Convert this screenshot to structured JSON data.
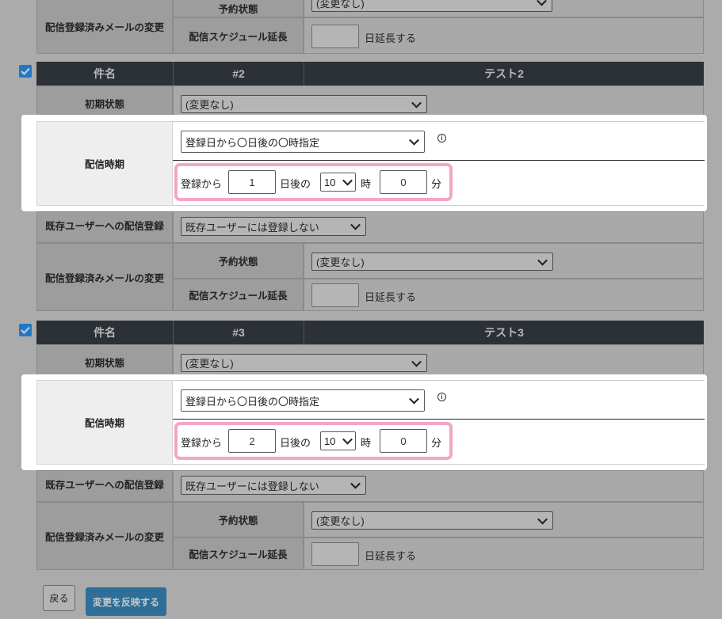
{
  "labels": {
    "subject": "件名",
    "initial_state": "初期状態",
    "delivery_time": "配信時期",
    "existing_user_registration": "既存ユーザーへの配信登録",
    "registered_mail_change": "配信登録済みメールの変更",
    "reservation_status": "予約状態",
    "schedule_extension": "配信スケジュール延長",
    "extension_suffix": "日延長する",
    "from_registration": "登録から",
    "days_after": "日後の",
    "hour": "時",
    "minute": "分"
  },
  "top_partial": {
    "reservation_status_value": "(変更なし)"
  },
  "blocks": [
    {
      "checked": true,
      "number": "#2",
      "title": "テスト2",
      "initial_state_value": "(変更なし)",
      "timing_select": "登録日から〇日後の〇時指定",
      "days": "1",
      "hour": "10",
      "minute": "0",
      "existing_user_value": "既存ユーザーには登録しない",
      "reservation_status_value": "(変更なし)",
      "extension_days": ""
    },
    {
      "checked": true,
      "number": "#3",
      "title": "テスト3",
      "initial_state_value": "(変更なし)",
      "timing_select": "登録日から〇日後の〇時指定",
      "days": "2",
      "hour": "10",
      "minute": "0",
      "existing_user_value": "既存ユーザーには登録しない",
      "reservation_status_value": "(変更なし)",
      "extension_days": ""
    }
  ],
  "buttons": {
    "back": "戻る",
    "apply": "変更を反映する"
  },
  "colors": {
    "header_bg": "#2b3137",
    "checkbox": "#1e78c7",
    "highlight": "#f2a6c8",
    "apply_button": "#2d6f98"
  }
}
